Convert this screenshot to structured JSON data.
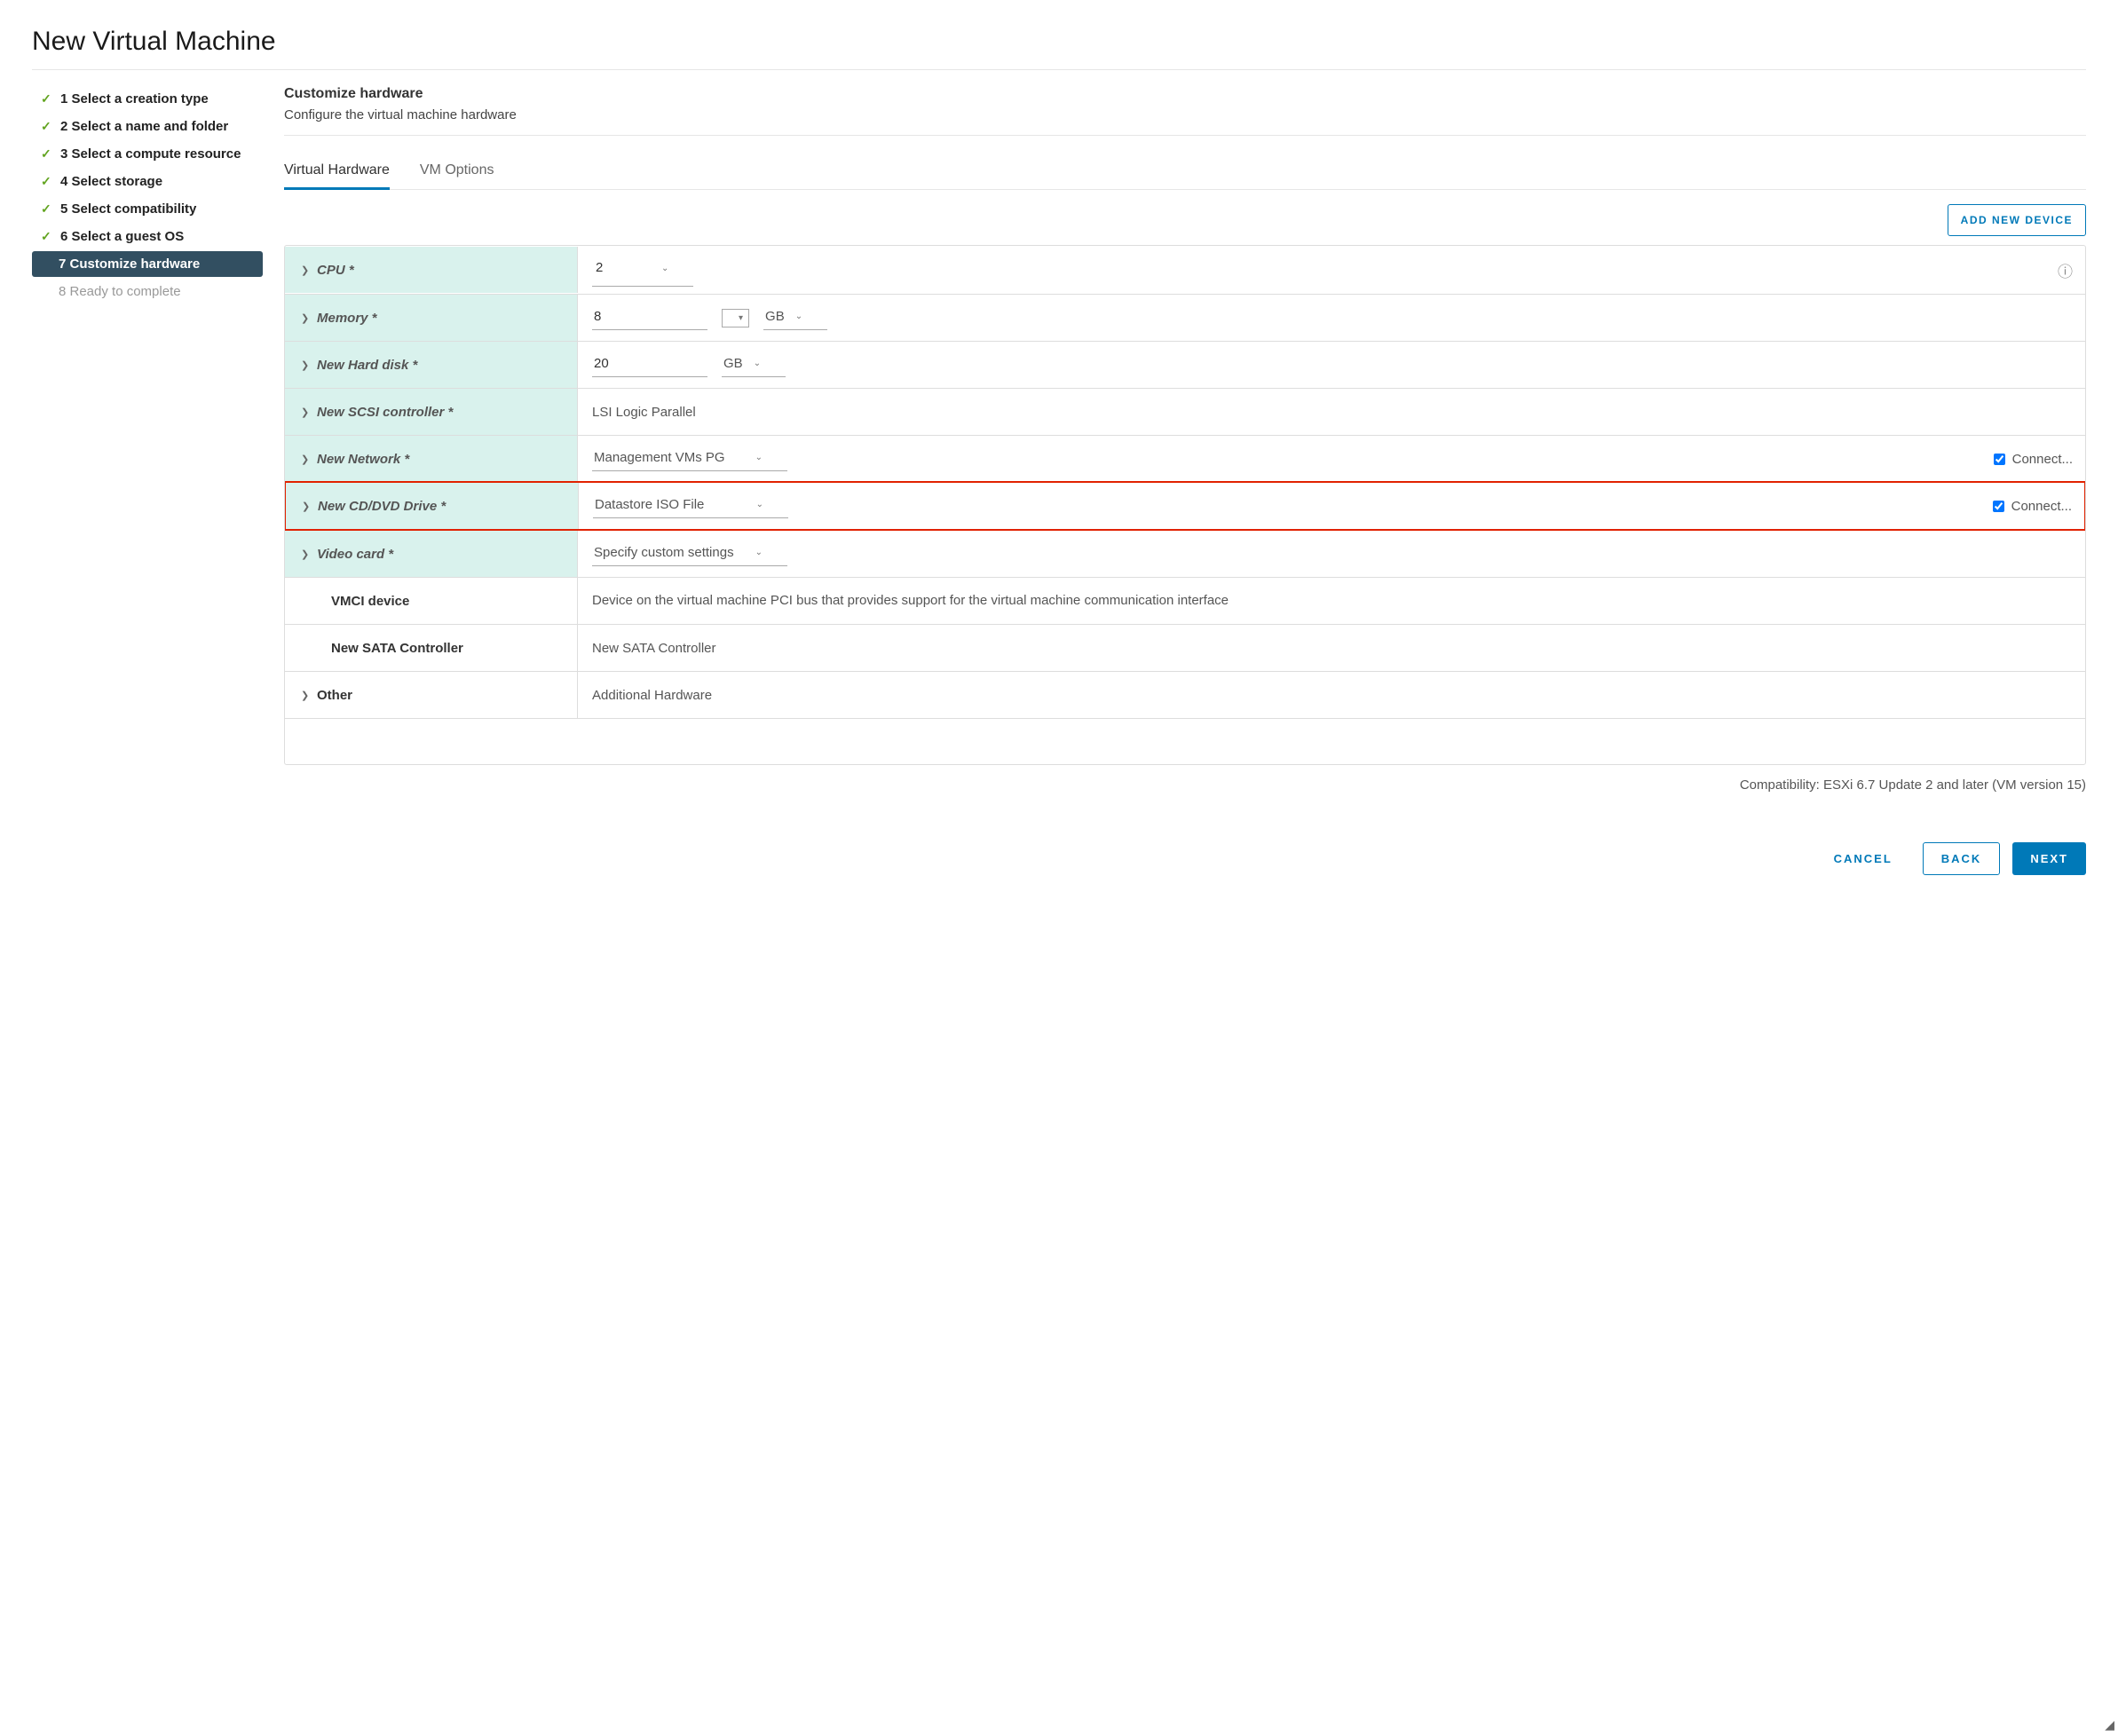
{
  "header": {
    "title": "New Virtual Machine"
  },
  "sidebar": {
    "steps": [
      {
        "label": "1 Select a creation type"
      },
      {
        "label": "2 Select a name and folder"
      },
      {
        "label": "3 Select a compute resource"
      },
      {
        "label": "4 Select storage"
      },
      {
        "label": "5 Select compatibility"
      },
      {
        "label": "6 Select a guest OS"
      },
      {
        "label": "7 Customize hardware"
      },
      {
        "label": "8 Ready to complete"
      }
    ]
  },
  "section": {
    "title": "Customize hardware",
    "desc": "Configure the virtual machine hardware"
  },
  "tabs": {
    "hardware": "Virtual Hardware",
    "options": "VM Options"
  },
  "add_device": "ADD NEW DEVICE",
  "hw": {
    "cpu": {
      "label": "CPU *",
      "value": "2"
    },
    "memory": {
      "label": "Memory *",
      "value": "8",
      "unit": "GB"
    },
    "disk": {
      "label": "New Hard disk *",
      "value": "20",
      "unit": "GB"
    },
    "scsi": {
      "label": "New SCSI controller *",
      "value": "LSI Logic Parallel"
    },
    "network": {
      "label": "New Network *",
      "value": "Management VMs PG",
      "connect": "Connect..."
    },
    "cd": {
      "label": "New CD/DVD Drive *",
      "value": "Datastore ISO File",
      "connect": "Connect..."
    },
    "video": {
      "label": "Video card *",
      "value": "Specify custom settings"
    },
    "vmci": {
      "label": "VMCI device",
      "value": "Device on the virtual machine PCI bus that provides support for the virtual machine communication interface"
    },
    "sata": {
      "label": "New SATA Controller",
      "value": "New SATA Controller"
    },
    "other": {
      "label": "Other",
      "value": "Additional Hardware"
    }
  },
  "compat": "Compatibility: ESXi 6.7 Update 2 and later (VM version 15)",
  "actions": {
    "cancel": "CANCEL",
    "back": "BACK",
    "next": "NEXT"
  }
}
